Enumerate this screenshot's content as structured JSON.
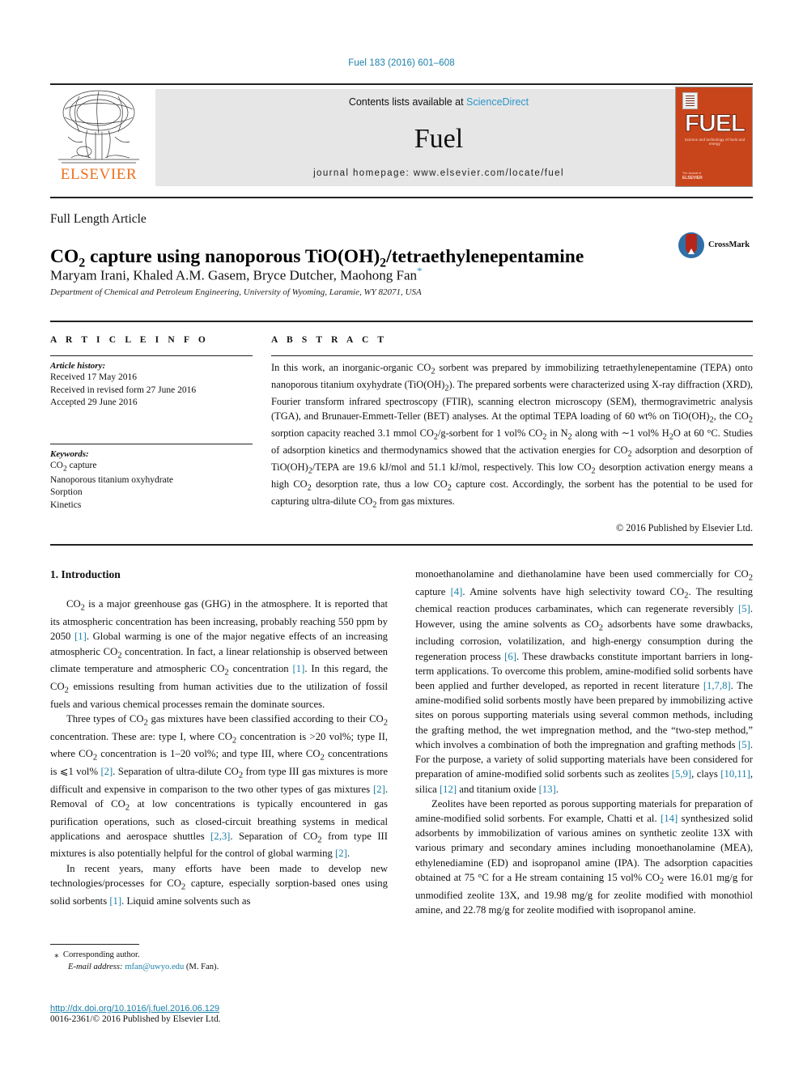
{
  "running_head": "Fuel 183 (2016) 601–608",
  "masthead": {
    "publisher": "ELSEVIER",
    "contents_prefix": "Contents lists available at ",
    "contents_link": "ScienceDirect",
    "journal_name": "Fuel",
    "homepage": "journal homepage: www.elsevier.com/locate/fuel",
    "cover": {
      "title": "FUEL",
      "subtitle": "Science and technology of fuels and energy",
      "footer_small": "The Journal of",
      "footer_bold": "ELSEVIER"
    },
    "link_color": "#2b96c8",
    "band_color": "#e6e6e6"
  },
  "article": {
    "type": "Full Length Article",
    "title_part1": "CO",
    "title_sub1": "2",
    "title_part2": " capture using nanoporous TiO(OH)",
    "title_sub2": "2",
    "title_part3": "/tetraethylenepentamine",
    "title_plain": "CO2 capture using nanoporous TiO(OH)2/tetraethylenepentamine",
    "authors": "Maryam Irani, Khaled A.M. Gasem, Bryce Dutcher, Maohong Fan",
    "corresponding_marker": "*",
    "affiliation": "Department of Chemical and Petroleum Engineering, University of Wyoming, Laramie, WY 82071, USA",
    "crossmark_label": "CrossMark"
  },
  "info": {
    "heading": "A R T I C L E   I N F O",
    "history_label": "Article history:",
    "history": [
      "Received 17 May 2016",
      "Received in revised form 27 June 2016",
      "Accepted 29 June 2016"
    ],
    "keywords_label": "Keywords:",
    "keywords": [
      "CO2 capture",
      "Nanoporous titanium oxyhydrate",
      "Sorption",
      "Kinetics"
    ]
  },
  "abstract": {
    "heading": "A B S T R A C T",
    "text": "In this work, an inorganic-organic CO2 sorbent was prepared by immobilizing tetraethylenepentamine (TEPA) onto nanoporous titanium oxyhydrate (TiO(OH)2). The prepared sorbents were characterized using X-ray diffraction (XRD), Fourier transform infrared spectroscopy (FTIR), scanning electron microscopy (SEM), thermogravimetric analysis (TGA), and Brunauer-Emmett-Teller (BET) analyses. At the optimal TEPA loading of 60 wt% on TiO(OH)2, the CO2 sorption capacity reached 3.1 mmol CO2/g-sorbent for 1 vol% CO2 in N2 along with ~1 vol% H2O at 60 °C. Studies of adsorption kinetics and thermodynamics showed that the activation energies for CO2 adsorption and desorption of TiO(OH)2/TEPA are 19.6 kJ/mol and 51.1 kJ/mol, respectively. This low CO2 desorption activation energy means a high CO2 desorption rate, thus a low CO2 capture cost. Accordingly, the sorbent has the potential to be used for capturing ultra-dilute CO2 from gas mixtures.",
    "copyright": "© 2016 Published by Elsevier Ltd."
  },
  "body": {
    "section_heading": "1. Introduction",
    "left_paragraphs": [
      "CO2 is a major greenhouse gas (GHG) in the atmosphere. It is reported that its atmospheric concentration has been increasing, probably reaching 550 ppm by 2050 [1]. Global warming is one of the major negative effects of an increasing atmospheric CO2 concentration. In fact, a linear relationship is observed between climate temperature and atmospheric CO2 concentration [1]. In this regard, the CO2 emissions resulting from human activities due to the utilization of fossil fuels and various chemical processes remain the dominate sources.",
      "Three types of CO2 gas mixtures have been classified according to their CO2 concentration. These are: type I, where CO2 concentration is >20 vol%; type II, where CO2 concentration is 1–20 vol%; and type III, where CO2 concentrations is ⩽1 vol% [2]. Separation of ultra-dilute CO2 from type III gas mixtures is more difficult and expensive in comparison to the two other types of gas mixtures [2]. Removal of CO2 at low concentrations is typically encountered in gas purification operations, such as closed-circuit breathing systems in medical applications and aerospace shuttles [2,3]. Separation of CO2 from type III mixtures is also potentially helpful for the control of global warming [2].",
      "In recent years, many efforts have been made to develop new technologies/processes for CO2 capture, especially sorption-based ones using solid sorbents [1]. Liquid amine solvents such as"
    ],
    "right_paragraphs": [
      "monoethanolamine and diethanolamine have been used commercially for CO2 capture [4]. Amine solvents have high selectivity toward CO2. The resulting chemical reaction produces carbaminates, which can regenerate reversibly [5]. However, using the amine solvents as CO2 adsorbents have some drawbacks, including corrosion, volatilization, and high-energy consumption during the regeneration process [6]. These drawbacks constitute important barriers in long-term applications. To overcome this problem, amine-modified solid sorbents have been applied and further developed, as reported in recent literature [1,7,8]. The amine-modified solid sorbents mostly have been prepared by immobilizing active sites on porous supporting materials using several common methods, including the grafting method, the wet impregnation method, and the \"two-step method,\" which involves a combination of both the impregnation and grafting methods [5]. For the purpose, a variety of solid supporting materials have been considered for preparation of amine-modified solid sorbents such as zeolites [5,9], clays [10,11], silica [12] and titanium oxide [13].",
      "Zeolites have been reported as porous supporting materials for preparation of amine-modified solid sorbents. For example, Chatti et al. [14] synthesized solid adsorbents by immobilization of various amines on synthetic zeolite 13X with various primary and secondary amines including monoethanolamine (MEA), ethylenediamine (ED) and isopropanol amine (IPA). The adsorption capacities obtained at 75 °C for a He stream containing 15 vol% CO2 were 16.01 mg/g for unmodified zeolite 13X, and 19.98 mg/g for zeolite modified with monothiol amine, and 22.78 mg/g for zeolite modified with isopropanol amine."
    ]
  },
  "footnote": {
    "corresponding": "Corresponding author.",
    "email_label": "E-mail address:",
    "email": "mfan@uwyo.edu",
    "email_suffix": "(M. Fan).",
    "doi": "http://dx.doi.org/10.1016/j.fuel.2016.06.129",
    "issn": "0016-2361/© 2016 Published by Elsevier Ltd."
  }
}
